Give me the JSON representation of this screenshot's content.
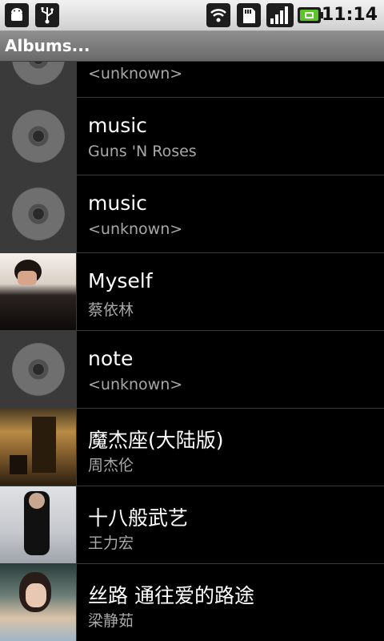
{
  "statusbar": {
    "time": "11:14",
    "icons": [
      "android-icon",
      "usb-icon",
      "wifi-icon",
      "sd-card-icon",
      "signal-icon",
      "battery-charging-icon"
    ]
  },
  "titlebar": {
    "title": "Albums..."
  },
  "albums": [
    {
      "title": "",
      "artist": "<unknown>",
      "art": "default-disc"
    },
    {
      "title": "music",
      "artist": "Guns 'N Roses",
      "art": "default-disc"
    },
    {
      "title": "music",
      "artist": "<unknown>",
      "art": "default-disc"
    },
    {
      "title": "Myself",
      "artist": "蔡依林",
      "art": "photo"
    },
    {
      "title": "note",
      "artist": "<unknown>",
      "art": "default-disc"
    },
    {
      "title": "魔杰座(大陆版)",
      "artist": "周杰伦",
      "art": "photo"
    },
    {
      "title": "十八般武艺",
      "artist": "王力宏",
      "art": "photo"
    },
    {
      "title": "丝路 通往爱的路途",
      "artist": "梁静茹",
      "art": "photo"
    }
  ]
}
